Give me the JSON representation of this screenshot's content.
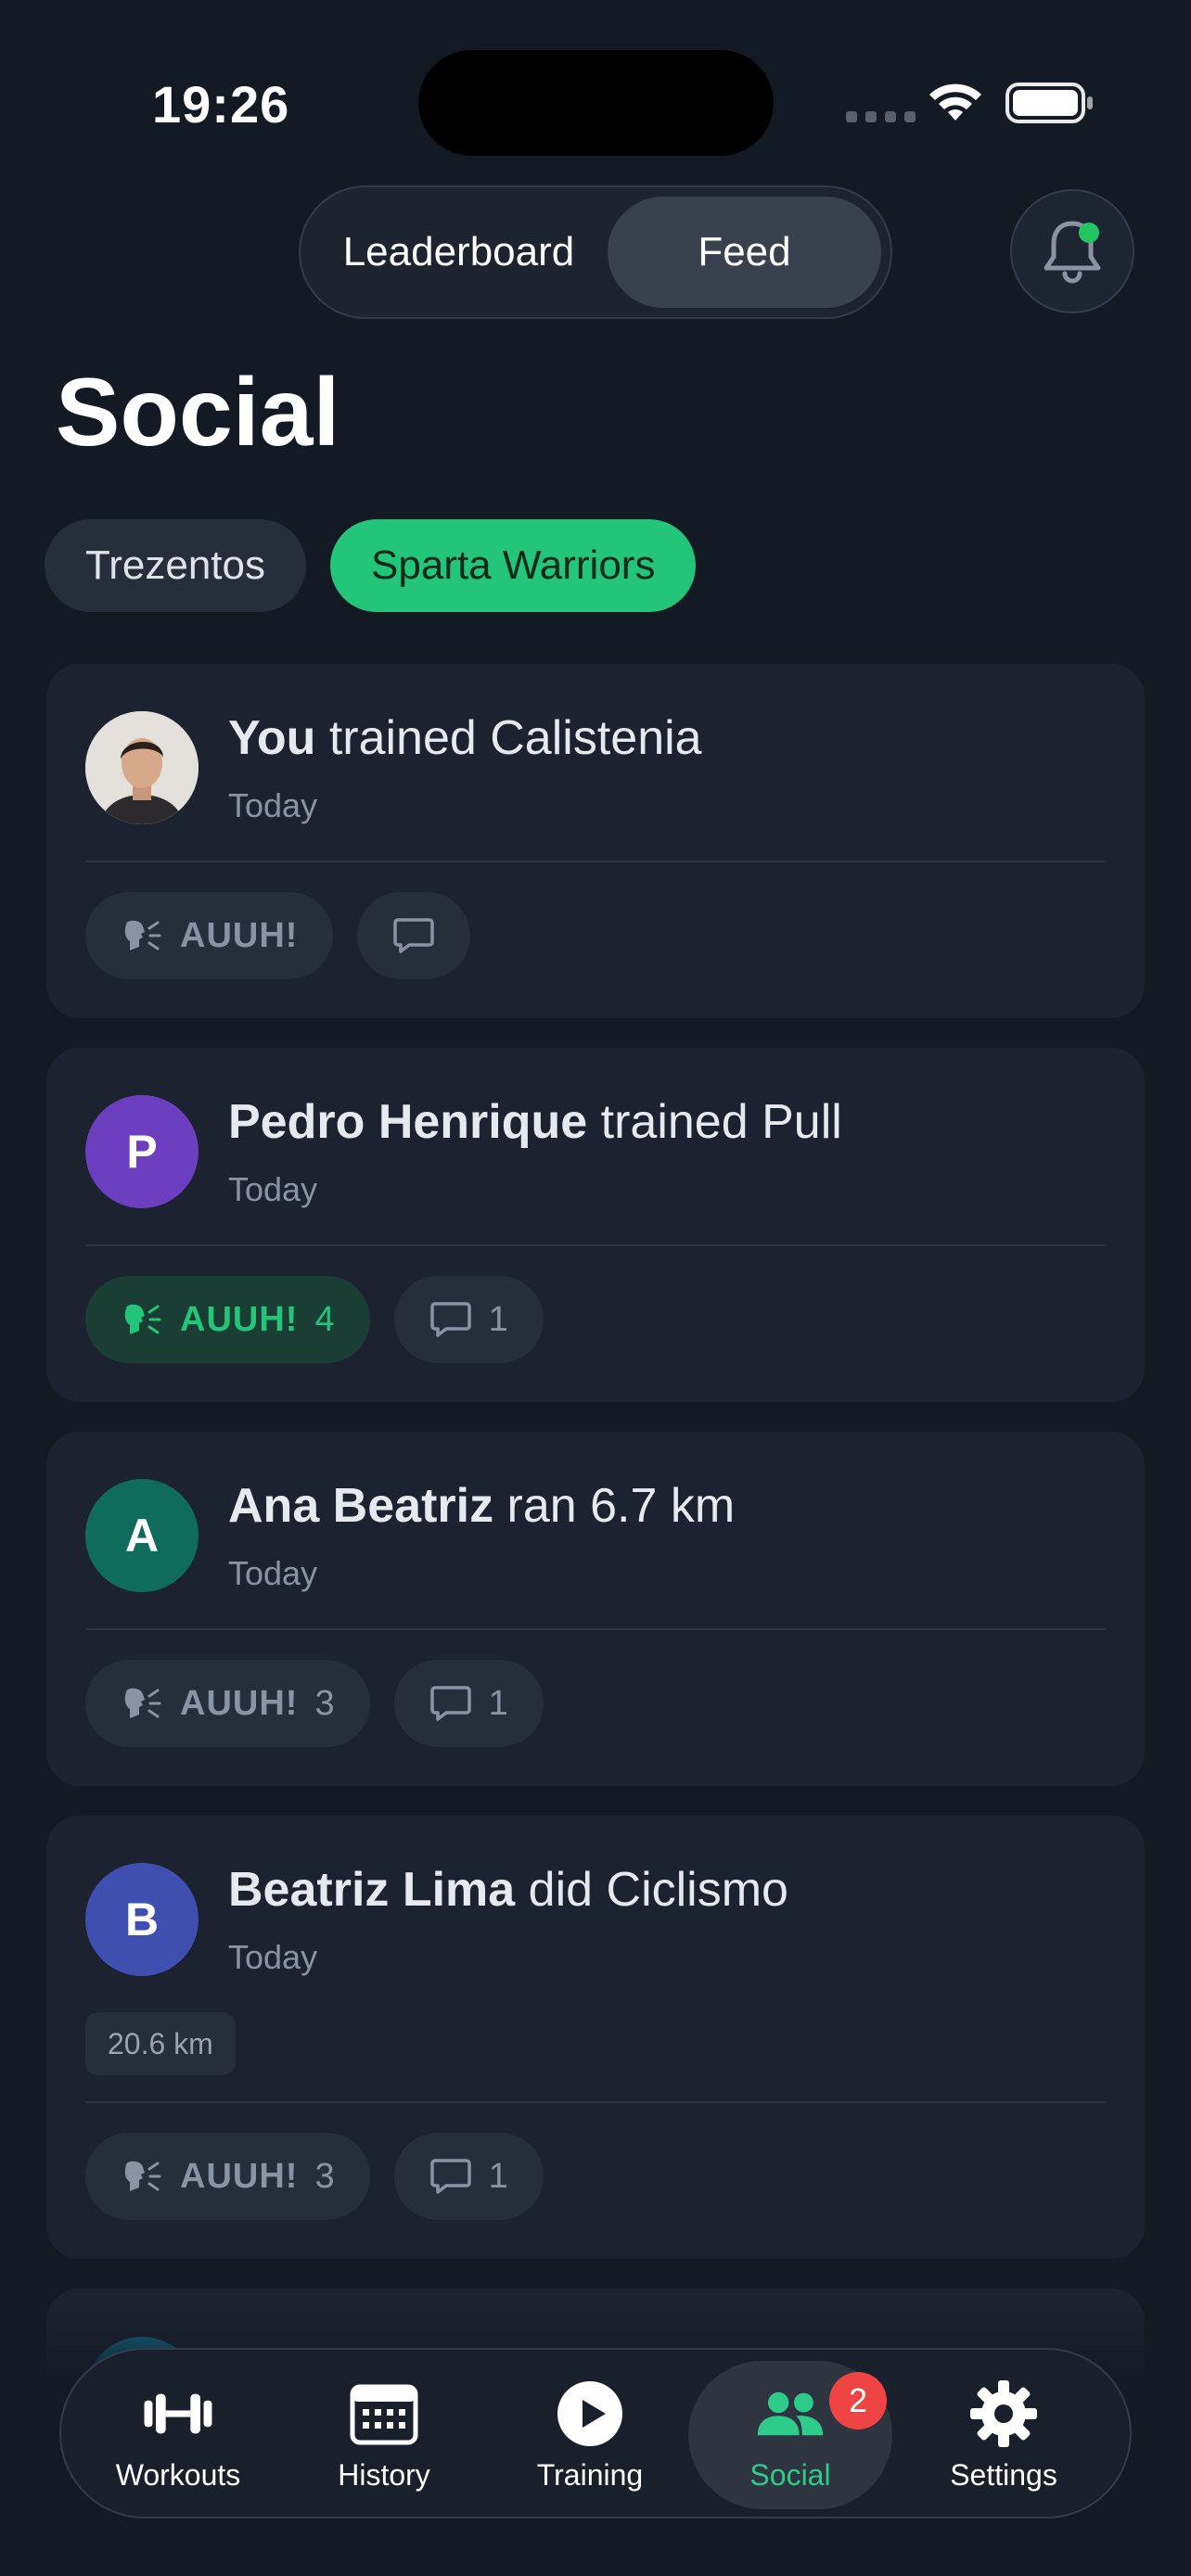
{
  "status": {
    "time": "19:26"
  },
  "segment": {
    "items": [
      "Leaderboard",
      "Feed"
    ],
    "selected": "Feed"
  },
  "page": {
    "title": "Social"
  },
  "groups": {
    "items": [
      "Trezentos",
      "Sparta Warriors"
    ],
    "selected": "Sparta Warriors"
  },
  "feed": [
    {
      "name": "You",
      "action": "trained Calistenia",
      "time": "Today",
      "avatar": "photo",
      "avatar_color": "#d9d4cf",
      "auuh_label": "AUUH!",
      "auuh_count": "",
      "comment_count": "",
      "reacted": false
    },
    {
      "name": "Pedro Henrique",
      "action": "trained Pull",
      "time": "Today",
      "avatar": "P",
      "avatar_color": "#6b3fc0",
      "auuh_label": "AUUH!",
      "auuh_count": "4",
      "comment_count": "1",
      "reacted": true
    },
    {
      "name": "Ana Beatriz",
      "action": "ran 6.7 km",
      "time": "Today",
      "avatar": "A",
      "avatar_color": "#0f6b5c",
      "auuh_label": "AUUH!",
      "auuh_count": "3",
      "comment_count": "1",
      "reacted": false
    },
    {
      "name": "Beatriz Lima",
      "action": "did Ciclismo",
      "time": "Today",
      "avatar": "B",
      "avatar_color": "#3f4fb0",
      "stat": "20.6 km",
      "auuh_label": "AUUH!",
      "auuh_count": "3",
      "comment_count": "1",
      "reacted": false
    }
  ],
  "nav": {
    "items": [
      {
        "label": "Workouts",
        "icon": "dumbbell-icon"
      },
      {
        "label": "History",
        "icon": "calendar-icon"
      },
      {
        "label": "Training",
        "icon": "play-icon"
      },
      {
        "label": "Social",
        "icon": "people-icon",
        "badge": "2"
      },
      {
        "label": "Settings",
        "icon": "gear-icon"
      }
    ],
    "selected": "Social"
  },
  "colors": {
    "accent": "#22c57a",
    "background": "#141a24",
    "card": "#1c2230",
    "badge": "#ef4444"
  }
}
